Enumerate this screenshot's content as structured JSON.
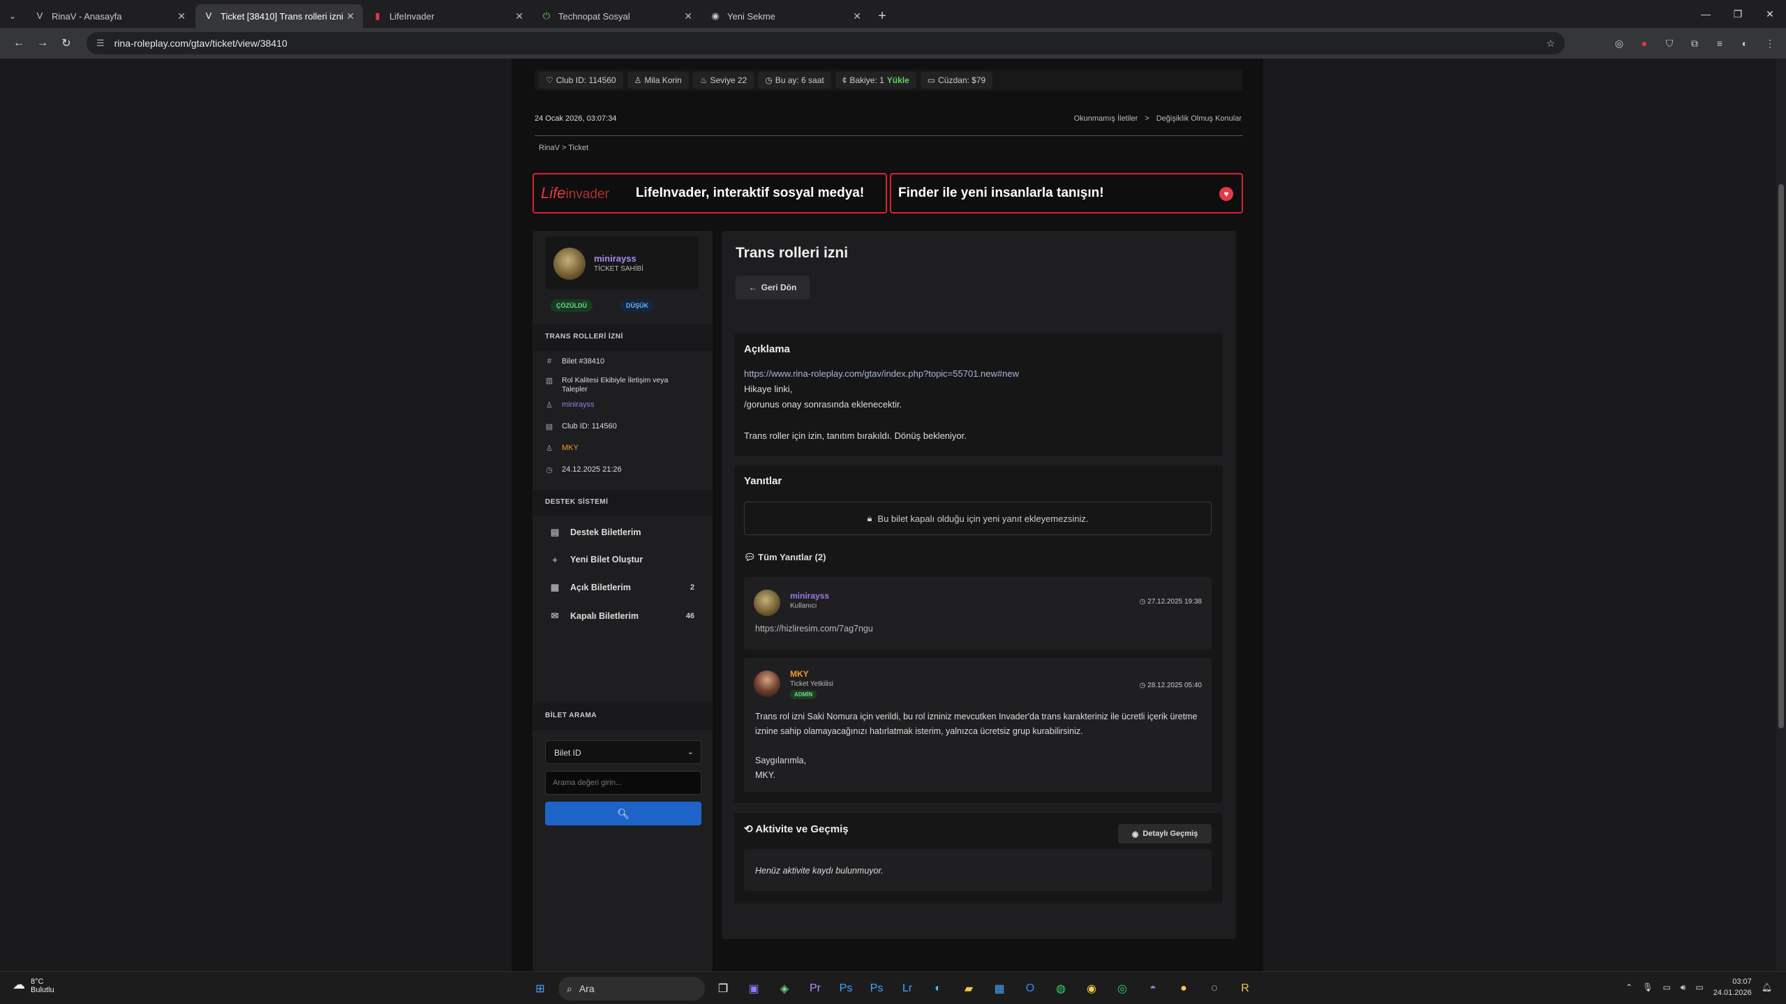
{
  "browser": {
    "tabs": [
      {
        "icon": "rinav-v-icon",
        "glyph": "V",
        "title": "RinaV - Anasayfa",
        "active": false
      },
      {
        "icon": "rinav-v-icon",
        "glyph": "V",
        "title": "Ticket [38410] Trans rolleri izni",
        "active": true
      },
      {
        "icon": "lifeinvader-icon",
        "glyph": "▮",
        "title": "LifeInvader",
        "active": false
      },
      {
        "icon": "power-icon",
        "glyph": "⏻",
        "title": "Technopat Sosyal",
        "active": false
      },
      {
        "icon": "chrome-icon",
        "glyph": "◉",
        "title": "Yeni Sekme",
        "active": false
      }
    ],
    "url": "rina-roleplay.com/gtav/ticket/view/38410"
  },
  "topbar": {
    "club_id": "Club ID: 114560",
    "name": "Mila Korin",
    "level": "Seviye 22",
    "month": "Bu ay: 6 saat",
    "balance_label": "Bakiye: 1",
    "balance_action": "Yükle",
    "wallet": "Cüzdan: $79"
  },
  "datetime": "24 Ocak 2026, 03:07:34",
  "top_links": {
    "unread": "Okunmamış İletiler",
    "sep": ">",
    "changed": "Değişiklik Olmuş Konular"
  },
  "breadcrumb": "RinaV > Ticket",
  "banners": {
    "logo_life": "Life",
    "logo_invader": "invader",
    "left_text": "LifeInvader, interaktif sosyal medya!",
    "right_text": "Finder ile yeni insanlarla tanışın!"
  },
  "sidebar": {
    "owner_name": "minirayss",
    "owner_role": "TİCKET SAHİBİ",
    "status_badge": "ÇÖZÜLDÜ",
    "priority_badge": "DÜŞÜK",
    "section_ticket": "TRANS ROLLERİ İZNİ",
    "ticket_no": "Bilet #38410",
    "category": "Rol Kalitesi Ekibiyle İletişim veya Talepler",
    "user": "minirayss",
    "club_id": "Club ID: 114560",
    "assignee": "MKY",
    "created": "24.12.2025 21:26",
    "section_support": "DESTEK SİSTEMİ",
    "menu": [
      {
        "label": "Destek Biletlerim",
        "icon": "ticket-icon",
        "glyph": "▤",
        "count": ""
      },
      {
        "label": "Yeni Bilet Oluştur",
        "icon": "plus-icon",
        "glyph": "+",
        "count": ""
      },
      {
        "label": "Açık Biletlerim",
        "icon": "inbox-icon",
        "glyph": "▦",
        "count": "2"
      },
      {
        "label": "Kapalı Biletlerim",
        "icon": "envelope-icon",
        "glyph": "✉",
        "count": "46"
      }
    ],
    "section_search": "BİLET ARAMA",
    "search_select": "Bilet ID",
    "search_placeholder": "Arama değeri girin..."
  },
  "main": {
    "title": "Trans rolleri izni",
    "back_label": "Geri Dön",
    "desc_title": "Açıklama",
    "desc_link": "https://www.rina-roleplay.com/gtav/index.php?topic=55701.new#new",
    "desc_line1": "Hikaye linki,",
    "desc_line2": "/gorunus onay sonrasında eklenecektir.",
    "desc_line3": "Trans roller için izin, tanıtım bırakıldı. Dönüş bekleniyor.",
    "replies_title": "Yanıtlar",
    "closed_notice": "Bu bilet kapalı olduğu için yeni yanıt ekleyemezsiniz.",
    "all_replies": "Tüm Yanıtlar (2)",
    "replies": [
      {
        "name": "minirayss",
        "role": "Kullanıcı",
        "date": "27.12.2025 19:38",
        "text": "https://hizliresim.com/7ag7ngu"
      },
      {
        "name": "MKY",
        "role": "Ticket Yetkilisi",
        "badge": "ADMİN",
        "date": "28.12.2025 05:40",
        "p1": "Trans rol izni Saki Nomura için verildi, bu rol izniniz mevcutken Invader'da trans karakteriniz ile ücretli içerik üretme iznine sahip olamayacağınızı hatırlatmak isterim, yalnızca ücretsiz grup kurabilirsiniz.",
        "p2": "Saygılarımla,",
        "p3": "MKY."
      }
    ],
    "activity_title": "Aktivite ve Geçmiş",
    "detail_btn": "Detaylı Geçmiş",
    "activity_empty": "Henüz aktivite kaydı bulunmuyor."
  },
  "taskbar": {
    "temp": "8°C",
    "weather": "Bulutlu",
    "search": "Ara",
    "time": "03:07",
    "date": "24.01.2026"
  }
}
